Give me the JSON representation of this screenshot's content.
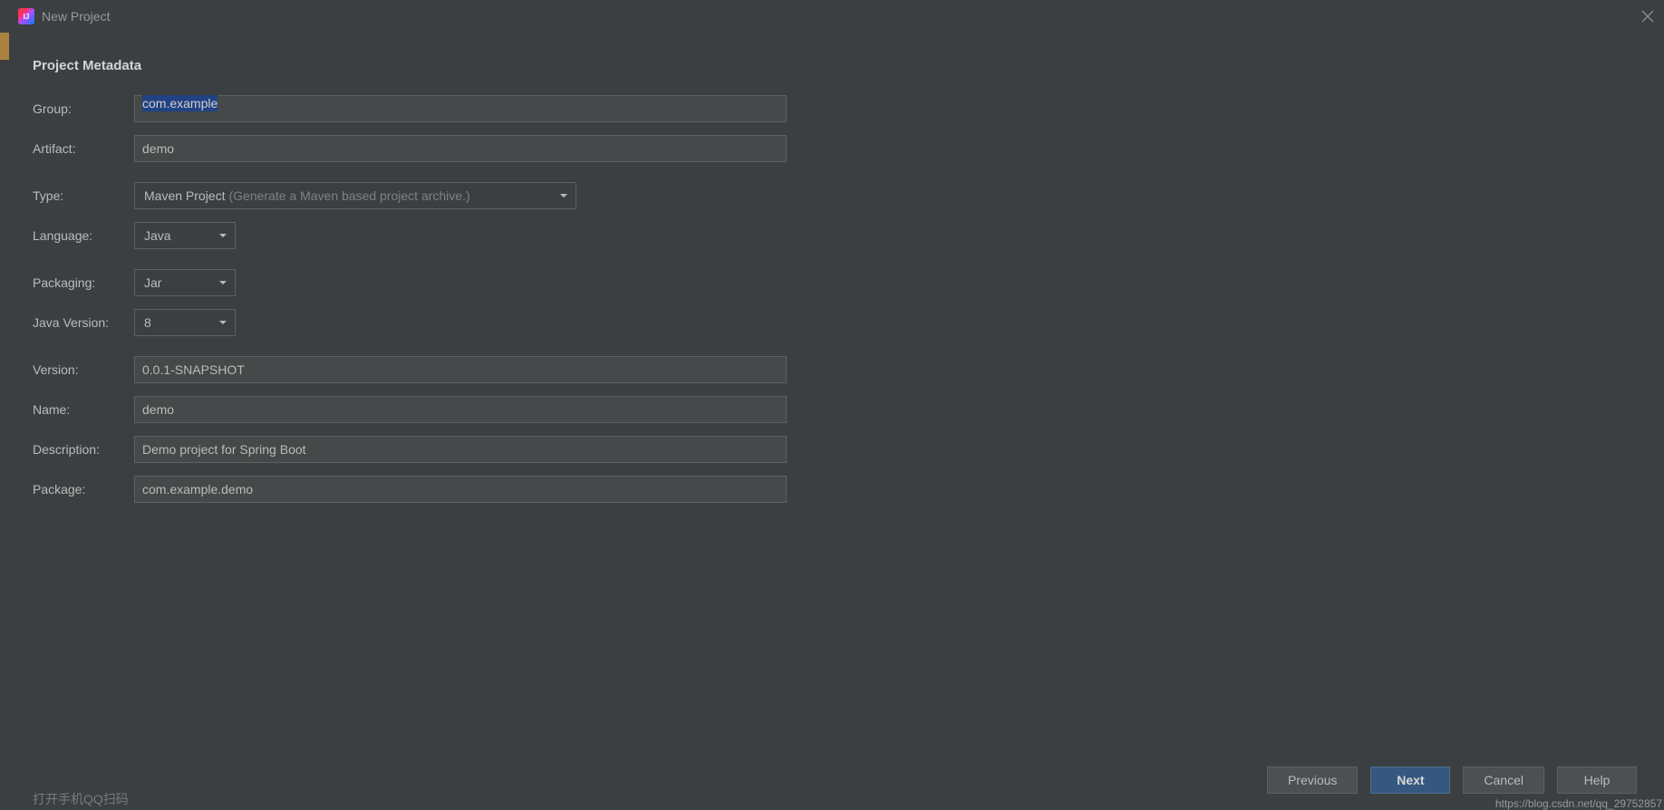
{
  "window": {
    "title": "New Project"
  },
  "section": {
    "title": "Project Metadata"
  },
  "labels": {
    "group": "Group:",
    "artifact": "Artifact:",
    "type": "Type:",
    "language": "Language:",
    "packaging": "Packaging:",
    "javaVersion": "Java Version:",
    "version": "Version:",
    "name": "Name:",
    "description": "Description:",
    "package": "Package:"
  },
  "values": {
    "group": "com.example",
    "artifact": "demo",
    "type": "Maven Project",
    "typeHint": "(Generate a Maven based project archive.)",
    "language": "Java",
    "packaging": "Jar",
    "javaVersion": "8",
    "version": "0.0.1-SNAPSHOT",
    "name": "demo",
    "description": "Demo project for Spring Boot",
    "package": "com.example.demo"
  },
  "buttons": {
    "previous": "Previous",
    "next": "Next",
    "cancel": "Cancel",
    "help": "Help"
  },
  "watermark": "https://blog.csdn.net/qq_29752857",
  "behind": "打开手机QQ扫码"
}
